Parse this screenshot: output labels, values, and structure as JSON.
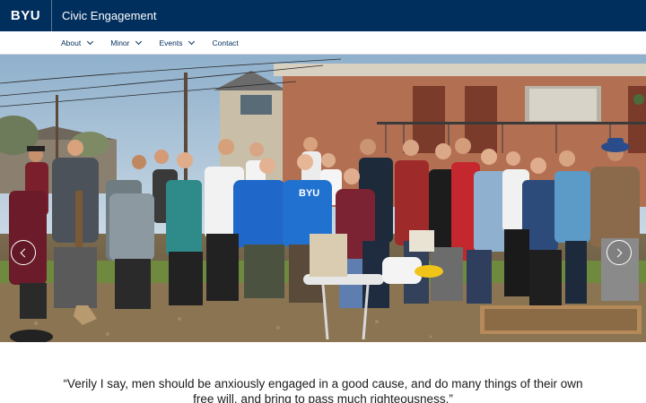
{
  "header": {
    "logo_text": "BYU",
    "site_title": "Civic Engagement"
  },
  "nav": {
    "items": [
      {
        "label": "About",
        "has_dropdown": true
      },
      {
        "label": "Minor",
        "has_dropdown": true
      },
      {
        "label": "Events",
        "has_dropdown": true
      },
      {
        "label": "Contact",
        "has_dropdown": false
      }
    ]
  },
  "hero": {
    "shirt_text": "BYU",
    "prev_icon": "chevron-left-icon",
    "next_icon": "chevron-right-icon"
  },
  "quote": {
    "line1": "“Verily I say, men should be anxiously engaged in a good cause, and do many things of their own",
    "line2": "free will, and bring to pass much righteousness.”"
  },
  "colors": {
    "brand_navy": "#002e5d",
    "page_bg": "#ffffff"
  }
}
